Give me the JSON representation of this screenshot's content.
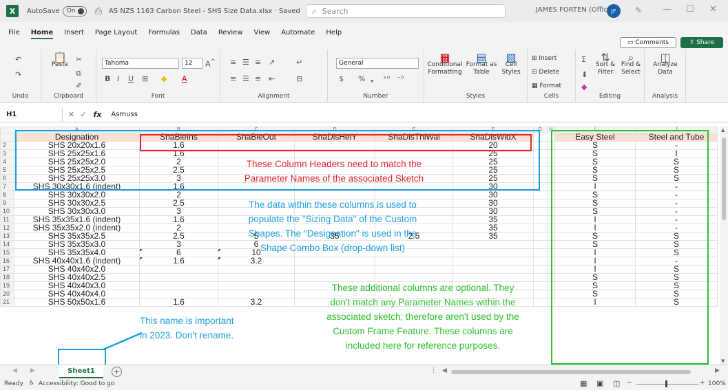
{
  "titlebar": {
    "app_logo": "X",
    "autosave_label": "AutoSave",
    "autosave_state": "On",
    "title": "AS NZS 1163 Carbon Steel - SHS Size Data.xlsx  ·  Saved",
    "search_placeholder": "Search",
    "user": "JAMES FORTEN (Office)",
    "user_initials": "JF"
  },
  "menu": {
    "items": [
      "File",
      "Home",
      "Insert",
      "Page Layout",
      "Formulas",
      "Data",
      "Review",
      "View",
      "Automate",
      "Help"
    ],
    "active": "Home",
    "comments": "Comments",
    "share": "Share"
  },
  "ribbon": {
    "undo": "Undo",
    "clipboard": "Clipboard",
    "paste": "Paste",
    "font_name": "Tahoma",
    "font_size": "12",
    "font": "Font",
    "alignment": "Alignment",
    "number_format": "General",
    "number": "Number",
    "cond_format": "Conditional Formatting",
    "format_table": "Format as Table",
    "cell_styles": "Cell Styles",
    "styles": "Styles",
    "insert": "Insert",
    "delete": "Delete",
    "format": "Format",
    "cells": "Cells",
    "sort_filter": "Sort & Filter",
    "find_select": "Find & Select",
    "editing": "Editing",
    "analyze_data": "Analyze Data",
    "analysis": "Analysis"
  },
  "formula_bar": {
    "name_box": "H1",
    "fx": "fx",
    "value": "Asmuss"
  },
  "grid": {
    "column_letters": [
      "A",
      "B",
      "C",
      "D",
      "E",
      "F",
      "G",
      "H",
      "I",
      "J"
    ],
    "headers": [
      "Designation",
      "ShaBleIns",
      "ShaBleOut",
      "ShaDisHeiY",
      "ShaDisThiWal",
      "ShaDisWidX",
      "",
      "",
      "Easy Steel",
      "Steel and Tube"
    ],
    "rows": [
      {
        "n": "2",
        "a": "SHS 20x20x1.6",
        "b": "1.6",
        "c": "",
        "d": "",
        "e": "",
        "f": "20",
        "i": "S",
        "j": "-"
      },
      {
        "n": "3",
        "a": "SHS 25x25x1.6",
        "b": "1.6",
        "c": "",
        "d": "",
        "e": "",
        "f": "25",
        "i": "S",
        "j": "I"
      },
      {
        "n": "4",
        "a": "SHS 25x25x2.0",
        "b": "2",
        "c": "",
        "d": "",
        "e": "",
        "f": "25",
        "i": "S",
        "j": "S"
      },
      {
        "n": "5",
        "a": "SHS 25x25x2.5",
        "b": "2.5",
        "c": "",
        "d": "",
        "e": "",
        "f": "25",
        "i": "S",
        "j": "S"
      },
      {
        "n": "6",
        "a": "SHS 25x25x3.0",
        "b": "3",
        "c": "",
        "d": "",
        "e": "",
        "f": "25",
        "i": "S",
        "j": "S"
      },
      {
        "n": "7",
        "a": "SHS 30x30x1.6 (indent)",
        "b": "1.6",
        "c": "",
        "d": "",
        "e": "",
        "f": "30",
        "i": "I",
        "j": "-"
      },
      {
        "n": "8",
        "a": "SHS 30x30x2.0",
        "b": "2",
        "c": "",
        "d": "",
        "e": "",
        "f": "30",
        "i": "S",
        "j": "-"
      },
      {
        "n": "9",
        "a": "SHS 30x30x2.5",
        "b": "2.5",
        "c": "",
        "d": "",
        "e": "",
        "f": "30",
        "i": "S",
        "j": "-"
      },
      {
        "n": "10",
        "a": "SHS 30x30x3.0",
        "b": "3",
        "c": "",
        "d": "",
        "e": "",
        "f": "30",
        "i": "S",
        "j": "-"
      },
      {
        "n": "11",
        "a": "SHS 35x35x1.6 (indent)",
        "b": "1.6",
        "c": "",
        "d": "",
        "e": "",
        "f": "35",
        "i": "I",
        "j": "-"
      },
      {
        "n": "12",
        "a": "SHS 35x35x2.0 (indent)",
        "b": "2",
        "c": "",
        "d": "",
        "e": "",
        "f": "35",
        "i": "I",
        "j": "-"
      },
      {
        "n": "13",
        "a": "SHS 35x35x2.5",
        "b": "2.5",
        "c": "5",
        "d": "35",
        "e": "2.5",
        "f": "35",
        "i": "S",
        "j": "S"
      },
      {
        "n": "14",
        "a": "SHS 35x35x3.0",
        "b": "3",
        "c": "6",
        "d": "",
        "e": "",
        "f": "",
        "i": "S",
        "j": "S"
      },
      {
        "n": "15",
        "a": "SHS 35x35x4.0",
        "b": "6",
        "c": "10",
        "d": "",
        "e": "",
        "f": "",
        "i": "I",
        "j": "S"
      },
      {
        "n": "16",
        "a": "SHS 40x40x1.6 (indent)",
        "b": "1.6",
        "c": "3.2",
        "d": "",
        "e": "",
        "f": "",
        "i": "I",
        "j": "-"
      },
      {
        "n": "17",
        "a": "SHS 40x40x2.0",
        "b": "",
        "c": "",
        "d": "",
        "e": "",
        "f": "",
        "i": "I",
        "j": "S"
      },
      {
        "n": "18",
        "a": "SHS 40x40x2.5",
        "b": "",
        "c": "",
        "d": "",
        "e": "",
        "f": "",
        "i": "S",
        "j": "S"
      },
      {
        "n": "19",
        "a": "SHS 40x40x3.0",
        "b": "",
        "c": "",
        "d": "",
        "e": "",
        "f": "",
        "i": "S",
        "j": "S"
      },
      {
        "n": "20",
        "a": "SHS 40x40x4.0",
        "b": "",
        "c": "",
        "d": "",
        "e": "",
        "f": "",
        "i": "S",
        "j": "S"
      },
      {
        "n": "21",
        "a": "SHS 50x50x1.6",
        "b": "1.6",
        "c": "3.2",
        "d": "",
        "e": "",
        "f": "",
        "i": "I",
        "j": "S"
      }
    ]
  },
  "annotations": {
    "red_line1": "These Column Headers need to match the",
    "red_line2": "Parameter Names of the associated Sketch",
    "blue_line1": "The data within these columns is used to",
    "blue_line2": "populate the \"Sizing Data\" of the Custom",
    "blue_line3": "Shapes. The \"Designation\" is used in the",
    "blue_line4": "Shape Combo Box (drop-down list)",
    "green_line1": "These additional columns are optional. They",
    "green_line2": "don't match any Parameter Names within the",
    "green_line3": "associated sketch; therefore aren't used by the",
    "green_line4": "Custom Frame Feature. These columns are",
    "green_line5": "included here for reference purposes.",
    "tab_line1": "This name is important",
    "tab_line2": "in 2023. Don't rename.",
    "colors": {
      "red": "#e3242b",
      "blue": "#1aa0e0",
      "green": "#2fc12f",
      "header_fill": "#fbe1d3",
      "excel_green": "#1e7145"
    }
  },
  "sheets": {
    "active": "Sheet1"
  },
  "status": {
    "ready": "Ready",
    "accessibility": "Accessibility: Good to go",
    "zoom": "100%"
  }
}
